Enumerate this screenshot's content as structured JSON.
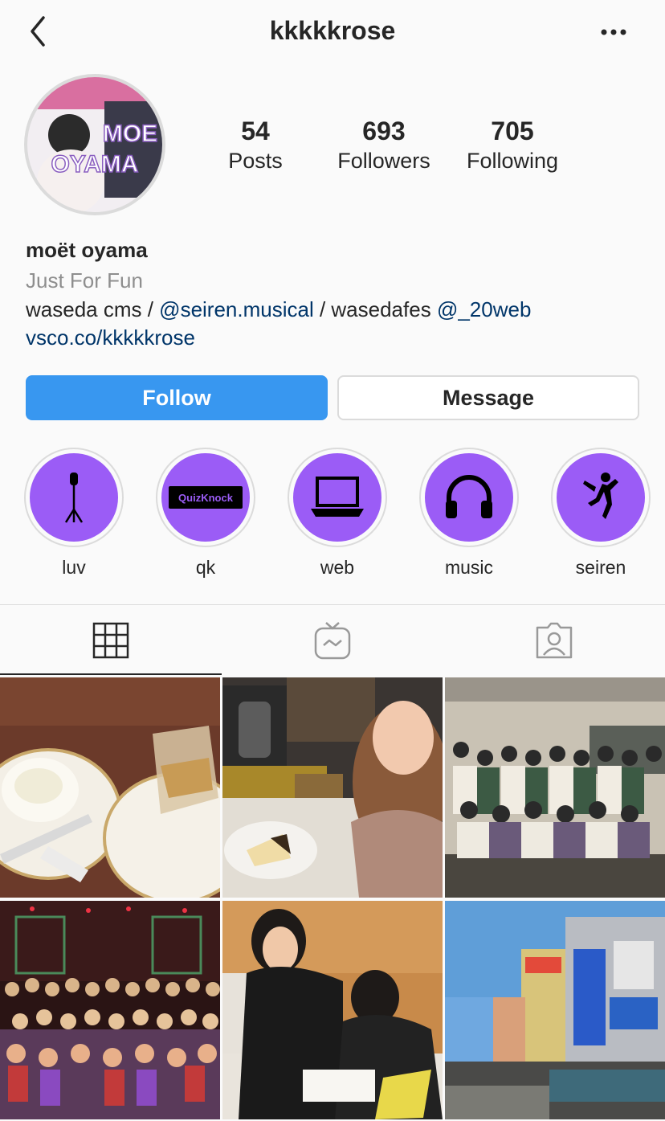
{
  "header": {
    "username": "kkkkkrose",
    "back_icon": "chevron-left-icon",
    "more_icon": "more-horizontal-icon"
  },
  "avatar": {
    "text_line1": "MOE",
    "text_line2": "OYAMA"
  },
  "stats": [
    {
      "value": "54",
      "label": "Posts"
    },
    {
      "value": "693",
      "label": "Followers"
    },
    {
      "value": "705",
      "label": "Following"
    }
  ],
  "profile": {
    "name": "moët oyama",
    "category": "Just For Fun",
    "bio_part1": "waseda cms / ",
    "bio_mention1": "@seiren.musical",
    "bio_part2": " / wasedafes ",
    "bio_mention2": "@_20web",
    "link": "vsco.co/kkkkkrose"
  },
  "buttons": {
    "follow": "Follow",
    "message": "Message"
  },
  "highlights": [
    {
      "label": "luv",
      "icon": "microphone-stand-icon"
    },
    {
      "label": "qk",
      "icon": "quizknock-logo",
      "logo_text": "QuizKnock"
    },
    {
      "label": "web",
      "icon": "laptop-icon"
    },
    {
      "label": "music",
      "icon": "headphones-icon"
    },
    {
      "label": "seiren",
      "icon": "jumping-person-icon"
    }
  ],
  "tabs": [
    {
      "name": "grid",
      "icon": "grid-icon",
      "active": true
    },
    {
      "name": "igtv",
      "icon": "tv-icon",
      "active": false
    },
    {
      "name": "tagged",
      "icon": "tagged-person-icon",
      "active": false
    }
  ],
  "colors": {
    "accent": "#3897f0",
    "highlight": "#9b5cf6",
    "mention": "#003569",
    "muted": "#8e8e8e",
    "border": "#dbdbdb"
  },
  "posts": [
    {
      "subject": "tea-and-pastries-photo"
    },
    {
      "subject": "cafe-selfie-photo"
    },
    {
      "subject": "group-photo-white-outfits"
    },
    {
      "subject": "stage-group-photo"
    },
    {
      "subject": "two-women-working-photo"
    },
    {
      "subject": "dotonbori-street-photo"
    }
  ]
}
